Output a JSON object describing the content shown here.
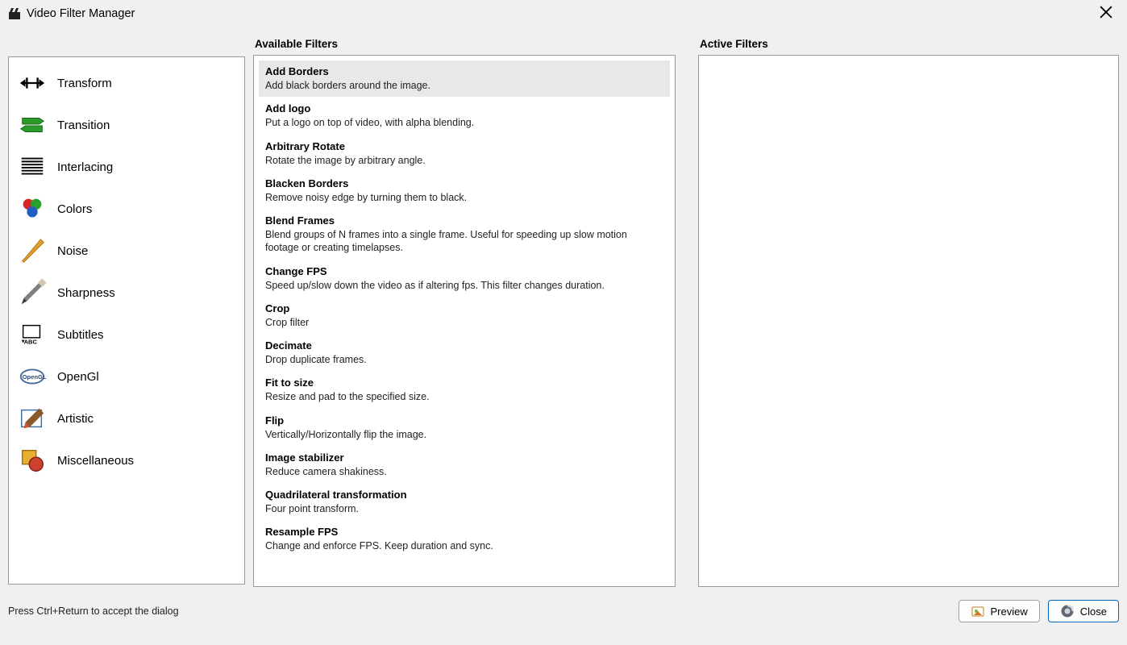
{
  "window": {
    "title": "Video Filter Manager"
  },
  "headers": {
    "available": "Available Filters",
    "active": "Active Filters"
  },
  "categories": [
    {
      "id": "transform",
      "label": "Transform"
    },
    {
      "id": "transition",
      "label": "Transition"
    },
    {
      "id": "interlacing",
      "label": "Interlacing"
    },
    {
      "id": "colors",
      "label": "Colors"
    },
    {
      "id": "noise",
      "label": "Noise"
    },
    {
      "id": "sharpness",
      "label": "Sharpness"
    },
    {
      "id": "subtitles",
      "label": "Subtitles"
    },
    {
      "id": "opengl",
      "label": "OpenGl"
    },
    {
      "id": "artistic",
      "label": "Artistic"
    },
    {
      "id": "miscellaneous",
      "label": "Miscellaneous"
    }
  ],
  "filters": [
    {
      "name": "Add Borders",
      "desc": "Add black borders around the image.",
      "selected": true
    },
    {
      "name": "Add logo",
      "desc": "Put a logo on top of video, with alpha blending."
    },
    {
      "name": "Arbitrary Rotate",
      "desc": "Rotate the image by arbitrary angle."
    },
    {
      "name": "Blacken Borders",
      "desc": "Remove noisy edge by turning them to black."
    },
    {
      "name": "Blend Frames",
      "desc": "Blend groups of N frames into a single frame.  Useful for speeding up slow motion footage or creating timelapses."
    },
    {
      "name": "Change FPS",
      "desc": "Speed up/slow down the video as if altering fps. This filter changes duration."
    },
    {
      "name": "Crop",
      "desc": "Crop filter"
    },
    {
      "name": "Decimate",
      "desc": "Drop duplicate frames."
    },
    {
      "name": "Fit to size",
      "desc": "Resize and pad to the specified size."
    },
    {
      "name": "Flip",
      "desc": "Vertically/Horizontally flip the image."
    },
    {
      "name": "Image stabilizer",
      "desc": "Reduce camera shakiness."
    },
    {
      "name": "Quadrilateral transformation",
      "desc": "Four point transform."
    },
    {
      "name": "Resample FPS",
      "desc": "Change and enforce FPS. Keep duration and sync."
    }
  ],
  "footer": {
    "hint": "Press Ctrl+Return to accept the dialog",
    "preview": "Preview",
    "close": "Close"
  },
  "icons": {
    "transform": "transform-icon",
    "transition": "transition-icon",
    "interlacing": "interlacing-icon",
    "colors": "colors-icon",
    "noise": "noise-icon",
    "sharpness": "sharpness-icon",
    "subtitles": "subtitles-icon",
    "opengl": "opengl-icon",
    "artistic": "artistic-icon",
    "miscellaneous": "miscellaneous-icon"
  }
}
